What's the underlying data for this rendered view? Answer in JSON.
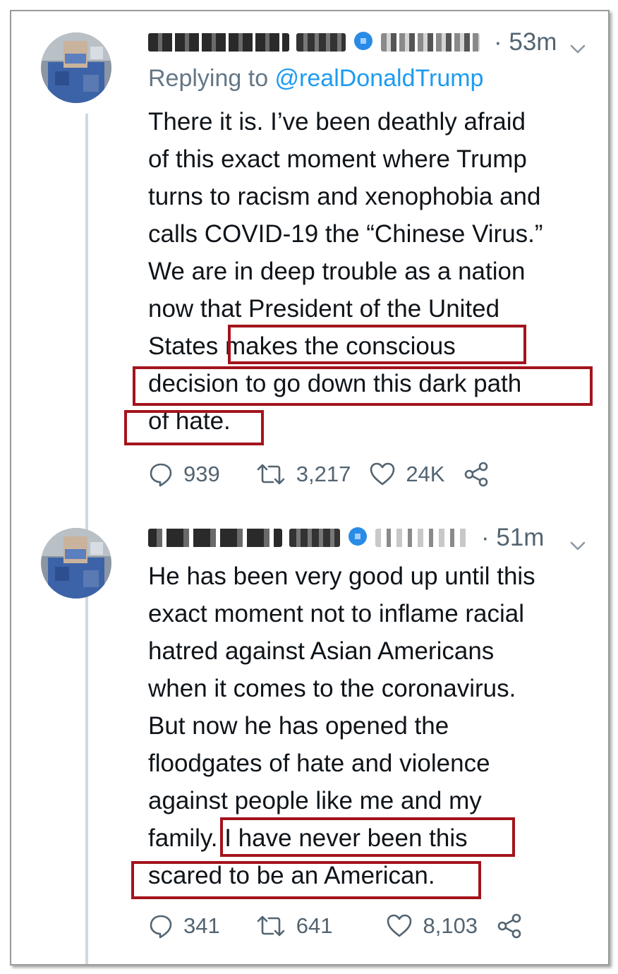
{
  "tweets": [
    {
      "time": "· 53m",
      "replying_prefix": "Replying to ",
      "replying_handle": "@realDonaldTrump",
      "lines": [
        "There it is. I’ve been deathly afraid",
        "of this exact moment where Trump",
        "turns to racism and xenophobia and",
        "calls COVID-19 the “Chinese Virus.”",
        "We are in deep trouble as a nation",
        "now that President of the United",
        "States makes the conscious",
        "decision to go down this dark path",
        "of hate."
      ],
      "replies": "939",
      "retweets": "3,217",
      "likes": "24K"
    },
    {
      "time": "· 51m",
      "lines": [
        "He has been very good up until this",
        "exact moment not to inflame racial",
        "hatred against Asian Americans",
        "when it comes to the coronavirus.",
        "But now he has opened the",
        "floodgates of hate and violence",
        "against people like me and my",
        "family. I have never been this",
        "scared to be an American."
      ],
      "replies": "341",
      "retweets": "641",
      "likes": "8,103"
    }
  ],
  "icons": [
    "reply-icon",
    "retweet-icon",
    "like-icon",
    "share-icon",
    "chevron-down-icon",
    "verified-badge-icon"
  ],
  "colors": {
    "highlight_box": "#a3141c",
    "link": "#1d9bf0",
    "muted": "#536471",
    "thread_line": "#cfd9de"
  }
}
